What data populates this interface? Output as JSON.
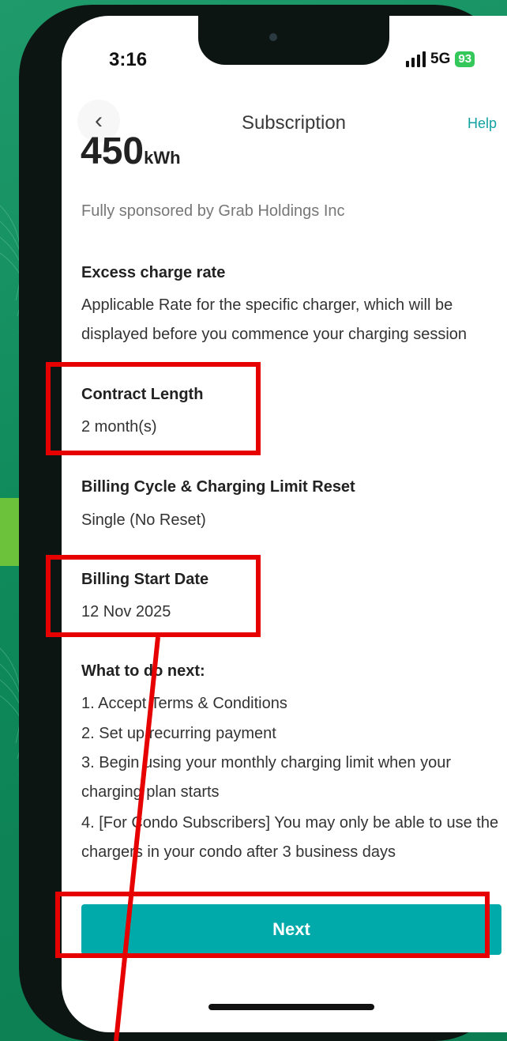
{
  "status_bar": {
    "time": "3:16",
    "network": "5G",
    "battery": "93"
  },
  "nav": {
    "back_icon": "chevron-left-icon",
    "title": "Subscription",
    "help_label": "Help"
  },
  "plan": {
    "energy_value": "450",
    "energy_unit": "kWh",
    "sponsor_text": "Fully sponsored by Grab Holdings Inc"
  },
  "details": {
    "excess_rate_label": "Excess charge rate",
    "excess_rate_value": "Applicable Rate for the specific charger, which will be displayed before you commence your charging session",
    "contract_length_label": "Contract Length",
    "contract_length_value": "2 month(s)",
    "billing_cycle_label": "Billing Cycle & Charging Limit Reset",
    "billing_cycle_value": "Single (No Reset)",
    "billing_start_label": "Billing Start Date",
    "billing_start_value": "12 Nov 2025"
  },
  "next_steps": {
    "heading": "What to do next:",
    "items": [
      "1. Accept Terms & Conditions",
      "2. Set up recurring payment",
      "3. Begin using your monthly charging limit when your charging plan starts",
      "4. [For Condo Subscribers] You may only be able to use the chargers in your condo after 3 business days"
    ]
  },
  "next_button": {
    "label": "Next"
  },
  "colors": {
    "accent": "#00aaaa",
    "highlight": "#e60000",
    "background": "#0f8a5a"
  }
}
